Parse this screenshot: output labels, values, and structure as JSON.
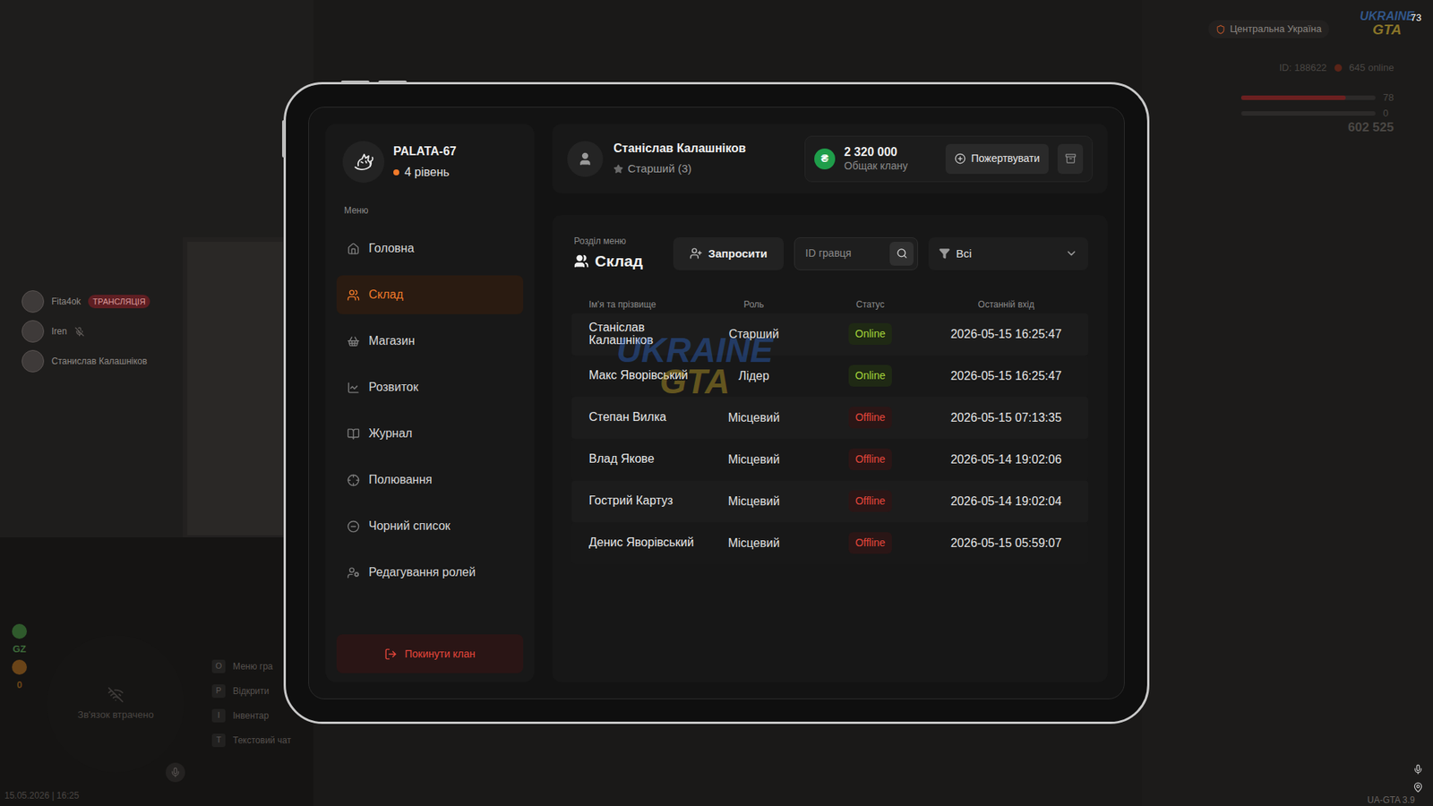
{
  "hud": {
    "region": "Центральна Україна",
    "logo": {
      "top": "UKRAINE",
      "bottom": "GTA"
    },
    "fps": "73",
    "player_id": "ID: 188622",
    "online": "645 online",
    "health": {
      "reading": "78",
      "level": 0.78
    },
    "armor": {
      "reading": "0",
      "level": 0
    },
    "money": "602 525",
    "datetime": "15.05.2026 | 16:25",
    "version": "UA-GTA 3.9",
    "voice": [
      {
        "name": "Fita4ok",
        "badge": "ТРАНСЛЯЦІЯ",
        "muted": false
      },
      {
        "name": "Iren",
        "muted": true
      },
      {
        "name": "Станислав Калашніков",
        "muted": false
      }
    ],
    "hints": [
      {
        "key": "O",
        "label": "Меню гра"
      },
      {
        "key": "P",
        "label": "Відкрити"
      },
      {
        "key": "I",
        "label": "Інвентар"
      },
      {
        "key": "T",
        "label": "Текстовий чат"
      }
    ],
    "minimap": "Зв'язок втрачено",
    "gz": "GZ",
    "gz_count": "0"
  },
  "clan": {
    "name": "PALATA-67",
    "level": "4 рівень"
  },
  "menu_label": "Меню",
  "menu": [
    {
      "label": "Головна",
      "selected": false
    },
    {
      "label": "Склад",
      "selected": true
    },
    {
      "label": "Магазин",
      "selected": false
    },
    {
      "label": "Розвиток",
      "selected": false
    },
    {
      "label": "Журнал",
      "selected": false
    },
    {
      "label": "Полювання",
      "selected": false
    },
    {
      "label": "Чорний список",
      "selected": false
    },
    {
      "label": "Редагування ролей",
      "selected": false
    }
  ],
  "leave_button": "Покинути клан",
  "user": {
    "name": "Станіслав Калашніков",
    "role": "Старший (3)"
  },
  "treasury": {
    "currency": "₴",
    "amount": "2 320 000",
    "label": "Общак клану",
    "donate": "Пожертвувати"
  },
  "section": {
    "caption": "Розділ меню",
    "title": "Склад"
  },
  "invite_button": "Запросити",
  "search": {
    "placeholder": "ID гравця"
  },
  "filter": {
    "value": "Всі"
  },
  "table": {
    "columns": [
      "Ім'я та прізвище",
      "Роль",
      "Статус",
      "Останній вхід"
    ],
    "rows": [
      {
        "name": "Станіслав Калашніков",
        "role": "Старший",
        "status": "Online",
        "online": true,
        "last_login": "2026-05-15 16:25:47"
      },
      {
        "name": "Макс Яворівський",
        "role": "Лідер",
        "status": "Online",
        "online": true,
        "last_login": "2026-05-15 16:25:47"
      },
      {
        "name": "Степан Вилка",
        "role": "Місцевий",
        "status": "Offline",
        "online": false,
        "last_login": "2026-05-15 07:13:35"
      },
      {
        "name": "Влад Якове",
        "role": "Місцевий",
        "status": "Offline",
        "online": false,
        "last_login": "2026-05-14 19:02:06"
      },
      {
        "name": "Гострий Картуз",
        "role": "Місцевий",
        "status": "Offline",
        "online": false,
        "last_login": "2026-05-14 19:02:04"
      },
      {
        "name": "Денис Яворівський",
        "role": "Місцевий",
        "status": "Offline",
        "online": false,
        "last_login": "2026-05-15 05:59:07"
      }
    ]
  }
}
